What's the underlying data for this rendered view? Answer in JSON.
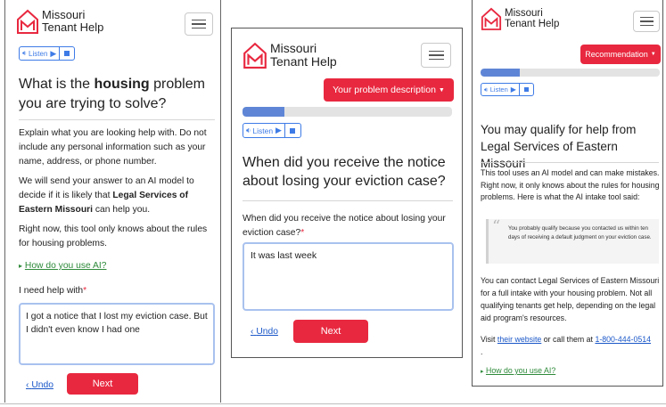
{
  "logo": {
    "line1": "Missouri",
    "line2": "Tenant Help"
  },
  "colors": {
    "accent_red": "#e8283f",
    "link_blue": "#1a57c8",
    "listen_blue": "#3e7be6",
    "progress_blue": "#5f86d6",
    "green_link": "#2e8a3a"
  },
  "icons": {
    "menu": "hamburger-menu-icon",
    "speaker": "speaker-icon",
    "play": "play-icon",
    "stop": "stop-icon",
    "logo": "house-m-logo-icon"
  },
  "panel1": {
    "listen_label": "Listen",
    "title_pre": "What is the ",
    "title_bold": "housing",
    "title_post": " problem you are trying to solve?",
    "para1": "Explain what you are looking help with. Do not include any personal information such as your name, address, or phone number.",
    "para2_pre": "We will send your answer to an AI model to decide if it is likely that ",
    "para2_bold": "Legal Services of Eastern Missouri",
    "para2_post": " can help you.",
    "para3": "Right now, this tool only knows about the rules for housing problems.",
    "ai_link": "How do you use AI?",
    "field_label": "I need help with",
    "required_mark": "*",
    "field_value": "I got a notice that I lost my eviction case. But I didn't even know I had one",
    "undo": "Undo",
    "next": "Next"
  },
  "panel2": {
    "dropdown_label": "Your problem description",
    "listen_label": "Listen",
    "progress": 0.2,
    "title": "When did you receive the notice about losing your eviction case?",
    "field_label": "When did you receive the notice about losing your eviction case?",
    "required_mark": "*",
    "field_value": "It was last week",
    "undo": "Undo",
    "next": "Next"
  },
  "panel3": {
    "dropdown_label": "Recommendation",
    "listen_label": "Listen",
    "progress": 0.22,
    "title": "You may qualify for help from Legal Services of Eastern Missouri",
    "para1": "This tool uses an AI model and can make mistakes. Right now, it only knows about the rules for housing problems. Here is what the AI intake tool said:",
    "quote": "You probably qualify because you contacted us within ten days of receiving a default judgment on your eviction case.",
    "para2": "You can contact Legal Services of Eastern Missouri for a full intake with your housing problem. Not all qualifying tenants get help, depending on the legal aid program's resources.",
    "visit_pre": "Visit ",
    "visit_link": "their website",
    "visit_mid": " or call them at ",
    "phone": "1-800-444-0514",
    "visit_end": ".",
    "ai_link": "How do you use AI?"
  }
}
